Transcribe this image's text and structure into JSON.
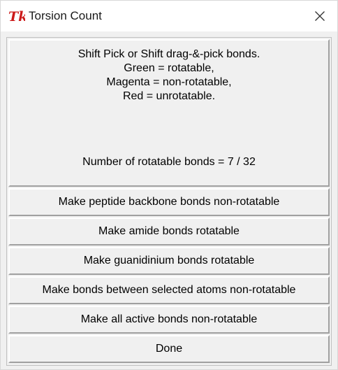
{
  "window": {
    "title": "Torsion Count",
    "icon": "tk-feather-icon",
    "close_icon": "close-icon"
  },
  "message": {
    "lines": [
      "Shift Pick or Shift drag-&-pick bonds.",
      "Green = rotatable,",
      "Magenta = non-rotatable,",
      "Red = unrotatable."
    ],
    "count_text": "Number of rotatable bonds = 7 / 32"
  },
  "buttons": [
    {
      "label": "Make peptide backbone bonds non-rotatable"
    },
    {
      "label": "Make amide bonds rotatable"
    },
    {
      "label": "Make guanidinium bonds rotatable"
    },
    {
      "label": "Make bonds between selected atoms non-rotatable"
    },
    {
      "label": "Make all active bonds non-rotatable"
    },
    {
      "label": "Done"
    }
  ]
}
